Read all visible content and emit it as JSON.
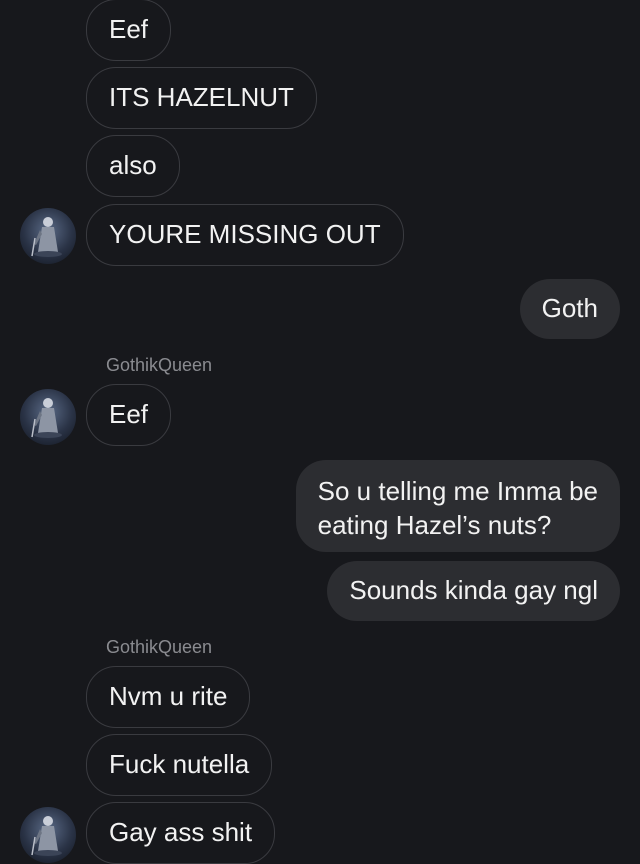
{
  "messages": {
    "m1": "Eef",
    "m2": "ITS HAZELNUT",
    "m3": "also",
    "m4": "YOURE MISSING OUT",
    "m5": "Goth",
    "sender1": "GothikQueen",
    "m6": "Eef",
    "m7": "So u telling me Imma be\neating Hazel’s nuts?",
    "m8": "Sounds kinda gay ngl",
    "sender2": "GothikQueen",
    "m9": "Nvm u rite",
    "m10": "Fuck nutella",
    "m11": "Gay ass shit"
  },
  "colors": {
    "background": "#17181c",
    "incoming_border": "#3a3b40",
    "outgoing_fill": "#2c2d31",
    "text": "#f2f2f2",
    "sender": "#8a8b90"
  }
}
